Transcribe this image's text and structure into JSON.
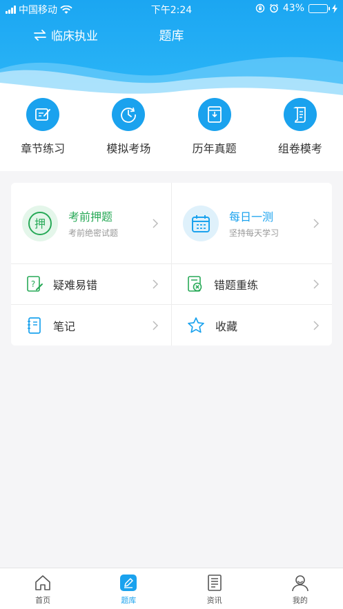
{
  "status": {
    "carrier": "中国移动",
    "time": "下午2:24",
    "battery": "43%",
    "battery_level": 0.43
  },
  "nav": {
    "switch_label": "临床执业",
    "title": "题库"
  },
  "categories": [
    {
      "label": "章节练习",
      "icon": "edit-square-icon"
    },
    {
      "label": "模拟考场",
      "icon": "clock-refresh-icon"
    },
    {
      "label": "历年真题",
      "icon": "document-bag-icon"
    },
    {
      "label": "组卷模考",
      "icon": "scroll-icon"
    }
  ],
  "features": {
    "predict": {
      "title": "考前押题",
      "subtitle": "考前绝密试题",
      "color": "#27a957"
    },
    "daily": {
      "title": "每日一测",
      "subtitle": "坚持每天学习",
      "color": "#1aa2ee"
    },
    "difficult": {
      "label": "疑难易错"
    },
    "wrong": {
      "label": "错题重练"
    },
    "notes": {
      "label": "笔记"
    },
    "favorites": {
      "label": "收藏"
    }
  },
  "tabs": [
    {
      "label": "首页"
    },
    {
      "label": "题库",
      "active": true
    },
    {
      "label": "资讯"
    },
    {
      "label": "我的"
    }
  ],
  "colors": {
    "accent": "#1aa2ee",
    "green": "#27a957"
  }
}
